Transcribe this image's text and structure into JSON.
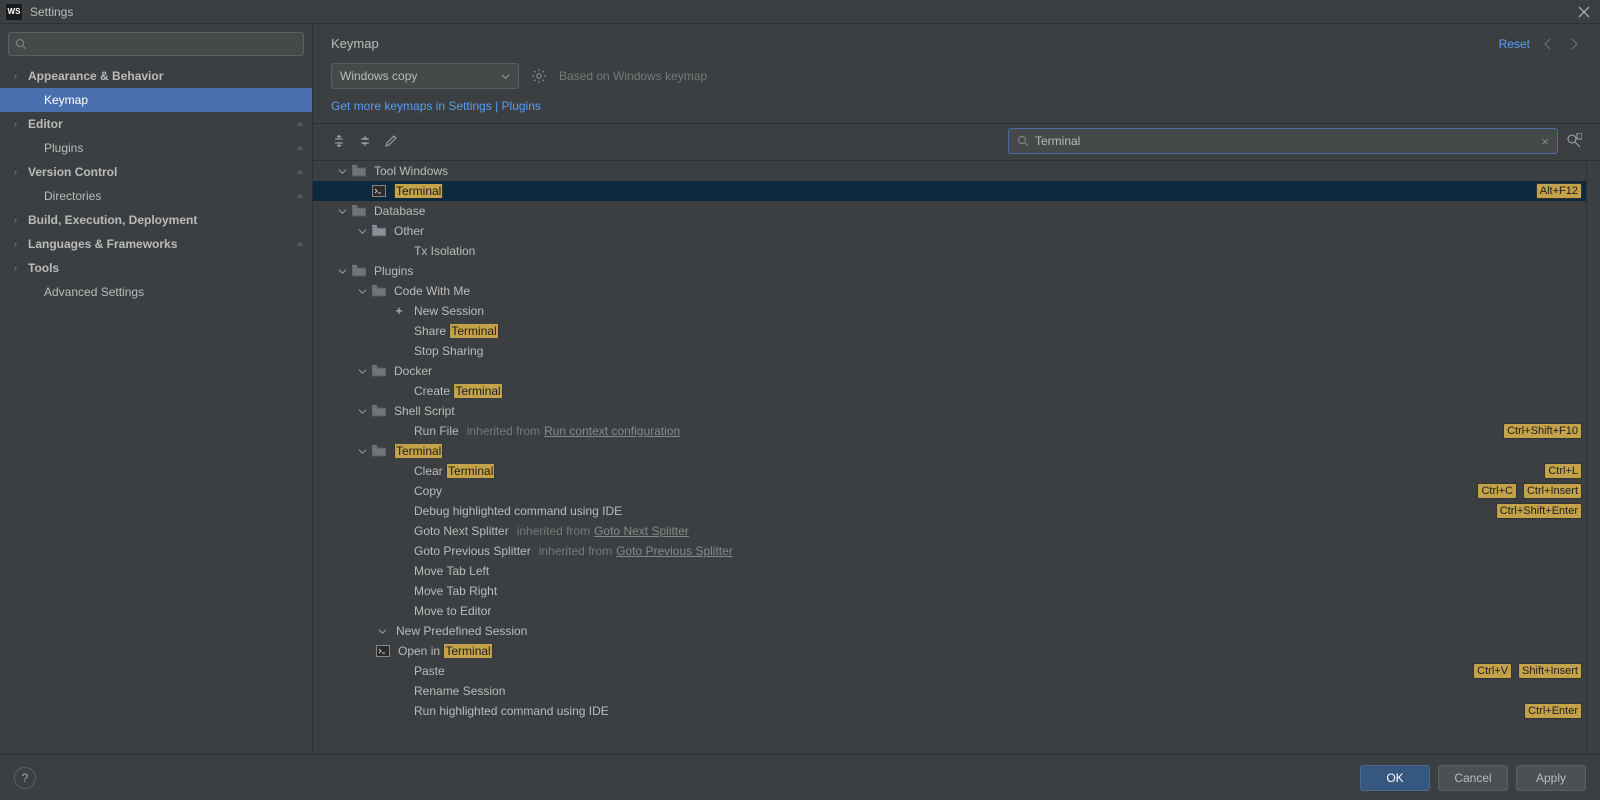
{
  "titlebar": {
    "title": "Settings",
    "logo": "WS"
  },
  "sidebar": {
    "items": [
      {
        "label": "Appearance & Behavior",
        "arrow": true,
        "bold": true,
        "dot": false
      },
      {
        "label": "Keymap",
        "arrow": false,
        "bold": false,
        "dot": false,
        "selected": true,
        "indent": 1
      },
      {
        "label": "Editor",
        "arrow": true,
        "bold": true,
        "dot": true
      },
      {
        "label": "Plugins",
        "arrow": false,
        "bold": false,
        "dot": true,
        "indent": 1
      },
      {
        "label": "Version Control",
        "arrow": true,
        "bold": true,
        "dot": true
      },
      {
        "label": "Directories",
        "arrow": false,
        "bold": false,
        "dot": true,
        "indent": 1
      },
      {
        "label": "Build, Execution, Deployment",
        "arrow": true,
        "bold": true,
        "dot": false
      },
      {
        "label": "Languages & Frameworks",
        "arrow": true,
        "bold": true,
        "dot": true
      },
      {
        "label": "Tools",
        "arrow": true,
        "bold": true,
        "dot": false
      },
      {
        "label": "Advanced Settings",
        "arrow": false,
        "bold": false,
        "dot": false,
        "indent": 1
      }
    ]
  },
  "content": {
    "title": "Keymap",
    "reset": "Reset",
    "dropdown": "Windows copy",
    "based_on": "Based on Windows keymap",
    "more_link": "Get more keymaps in Settings | Plugins",
    "search_value": "Terminal"
  },
  "actions": [
    {
      "depth": 0,
      "arrow": true,
      "icon": "folder",
      "text": "Tool Windows"
    },
    {
      "depth": 1,
      "icon": "terminal",
      "hl": "Terminal",
      "selected": true,
      "shortcuts": [
        "Alt+F12"
      ]
    },
    {
      "depth": 0,
      "arrow": true,
      "icon": "folder",
      "text": "Database"
    },
    {
      "depth": 1,
      "arrow": true,
      "icon": "folder-color",
      "text": "Other"
    },
    {
      "depth": 2,
      "text": "Tx Isolation"
    },
    {
      "depth": 0,
      "arrow": true,
      "icon": "folder",
      "text": "Plugins"
    },
    {
      "depth": 1,
      "arrow": true,
      "icon": "folder",
      "text": "Code With Me"
    },
    {
      "depth": 2,
      "icon": "plus",
      "text": "New Session"
    },
    {
      "depth": 2,
      "text": "Share ",
      "hl": "Terminal"
    },
    {
      "depth": 2,
      "text": "Stop Sharing"
    },
    {
      "depth": 1,
      "arrow": true,
      "icon": "folder",
      "text": "Docker"
    },
    {
      "depth": 2,
      "text": "Create ",
      "hl": "Terminal"
    },
    {
      "depth": 1,
      "arrow": true,
      "icon": "folder",
      "text": "Shell Script"
    },
    {
      "depth": 2,
      "text": "Run File",
      "inherited": "inherited from ",
      "inherited_link": "Run context configuration",
      "shortcuts": [
        "Ctrl+Shift+F10"
      ]
    },
    {
      "depth": 1,
      "arrow": true,
      "icon": "folder",
      "hl": "Terminal"
    },
    {
      "depth": 2,
      "text": "Clear ",
      "hl": "Terminal",
      "shortcuts": [
        "Ctrl+L"
      ]
    },
    {
      "depth": 2,
      "text": "Copy",
      "shortcuts": [
        "Ctrl+C",
        "Ctrl+Insert"
      ]
    },
    {
      "depth": 2,
      "text": "Debug highlighted command using IDE",
      "shortcuts": [
        "Ctrl+Shift+Enter"
      ]
    },
    {
      "depth": 2,
      "text": "Goto Next Splitter",
      "inherited": "inherited from ",
      "inherited_link": "Goto Next Splitter"
    },
    {
      "depth": 2,
      "text": "Goto Previous Splitter",
      "inherited": "inherited from ",
      "inherited_link": "Goto Previous Splitter"
    },
    {
      "depth": 2,
      "text": "Move Tab Left"
    },
    {
      "depth": 2,
      "text": "Move Tab Right"
    },
    {
      "depth": 2,
      "text": "Move to Editor"
    },
    {
      "depth": 2,
      "arrow": true,
      "noicon": true,
      "text": "New Predefined Session"
    },
    {
      "depth": 2,
      "icon": "terminal",
      "iconShift": true,
      "text": "Open in ",
      "hl": "Terminal"
    },
    {
      "depth": 2,
      "text": "Paste",
      "shortcuts": [
        "Ctrl+V",
        "Shift+Insert"
      ]
    },
    {
      "depth": 2,
      "text": "Rename Session"
    },
    {
      "depth": 2,
      "text": "Run highlighted command using IDE",
      "shortcuts": [
        "Ctrl+Enter"
      ]
    }
  ],
  "footer": {
    "ok": "OK",
    "cancel": "Cancel",
    "apply": "Apply"
  }
}
